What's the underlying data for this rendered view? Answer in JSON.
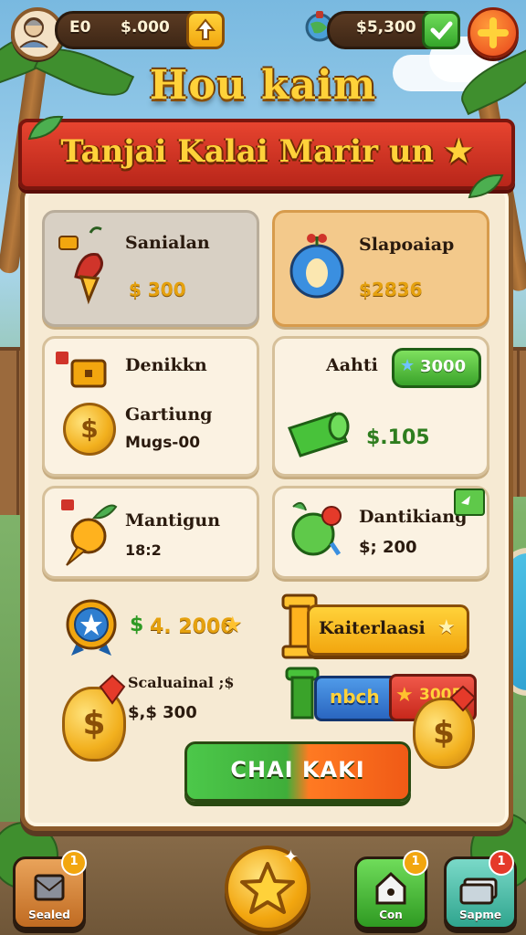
{
  "hud": {
    "left_label": "E0",
    "left_amount": "$.000",
    "right_amount": "$5,300"
  },
  "title": "Hou kaim",
  "banner": "Tanjai Kalai Marir un",
  "items": [
    {
      "title": "Sanialan",
      "price": "$ 300",
      "style": "gray",
      "icon": "bell-fruit-icon"
    },
    {
      "title": "Slapoaiap",
      "price": "$2836",
      "style": "orange",
      "icon": "blue-fruit-icon"
    },
    {
      "title": "Denikkn",
      "subtitle": "Gartiung",
      "price": "Mugs-00",
      "icon": "gold-coin-icon"
    },
    {
      "title": "Aahti",
      "price": "$.105",
      "badge": "3000",
      "icon": "green-banknote-icon"
    },
    {
      "title": "Mantigun",
      "price": "18:2",
      "icon": "carrot-icon"
    },
    {
      "title": "Dantikiang",
      "price": "$; 200",
      "icon": "green-apple-icon"
    }
  ],
  "bonus": {
    "medal_value": "4. 2006",
    "wide_button_label": "Kaiterlaasi",
    "seasonal_title": "Scaluainal ;$",
    "seasonal_price": "$,$ 300",
    "blue_button_label": "nbch",
    "red_button_label": "3005"
  },
  "cta_label": "CHAI KAKI",
  "nav": {
    "left_label": "Sealed",
    "left_badge": "1",
    "home_label": "Con",
    "home_badge": "1",
    "shop_label": "Sapme",
    "shop_badge": "1"
  },
  "colors": {
    "accent_gold": "#ffd23a",
    "banner_red": "#d1331f",
    "panel_cream": "#f6ead3",
    "cta_green": "#4cc84a",
    "cta_orange": "#f05a16"
  }
}
